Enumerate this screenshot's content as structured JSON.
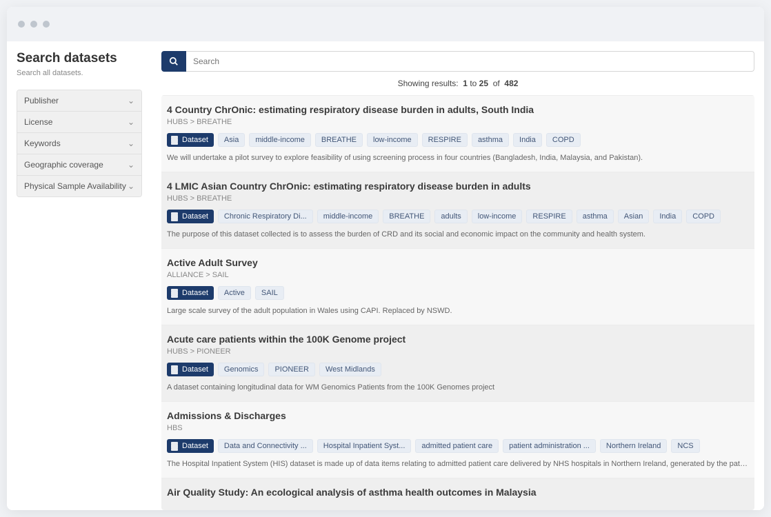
{
  "sidebar": {
    "title": "Search datasets",
    "subtitle": "Search all datasets.",
    "filters": [
      {
        "label": "Publisher"
      },
      {
        "label": "License"
      },
      {
        "label": "Keywords"
      },
      {
        "label": "Geographic coverage"
      },
      {
        "label": "Physical Sample Availability"
      }
    ]
  },
  "search": {
    "placeholder": "Search"
  },
  "results_info": {
    "prefix": "Showing results:",
    "from": "1",
    "mid": "to",
    "to": "25",
    "of_word": "of",
    "total": "482"
  },
  "badge_dataset_label": "Dataset",
  "results": [
    {
      "title": "4 Country ChrOnic: estimating respiratory disease burden in adults, South India",
      "breadcrumb": "HUBS > BREATHE",
      "tags": [
        "Asia",
        "middle-income",
        "BREATHE",
        "low-income",
        "RESPIRE",
        "asthma",
        "India",
        "COPD"
      ],
      "desc": "We will undertake a pilot survey to explore feasibility of using screening process in four countries (Bangladesh, India, Malaysia, and Pakistan)."
    },
    {
      "title": "4 LMIC Asian Country ChrOnic: estimating respiratory disease burden in adults",
      "breadcrumb": "HUBS > BREATHE",
      "tags": [
        "Chronic Respiratory Di...",
        "middle-income",
        "BREATHE",
        "adults",
        "low-income",
        "RESPIRE",
        "asthma",
        "Asian",
        "India",
        "COPD"
      ],
      "desc": "The purpose of this dataset collected is to assess the burden of CRD and its social and economic impact on the community and health system."
    },
    {
      "title": "Active Adult Survey",
      "breadcrumb": "ALLIANCE > SAIL",
      "tags": [
        "Active",
        "SAIL"
      ],
      "desc": "Large scale survey of the adult population in Wales using CAPI. Replaced by NSWD."
    },
    {
      "title": "Acute care patients within the 100K Genome project",
      "breadcrumb": "HUBS > PIONEER",
      "tags": [
        "Genomics",
        "PIONEER",
        "West Midlands"
      ],
      "desc": "A dataset containing longitudinal data for WM Genomics Patients from the 100K Genomes project"
    },
    {
      "title": "Admissions & Discharges",
      "breadcrumb": "HBS",
      "tags": [
        "Data and Connectivity ...",
        "Hospital Inpatient Syst...",
        "admitted patient care",
        "patient administration ...",
        "Northern Ireland",
        "NCS"
      ],
      "desc": "The Hospital Inpatient System (HIS) dataset is made up of data items relating to admitted patient care delivered by NHS hospitals in Northern Ireland, generated by the patient administration systems within each hos..."
    },
    {
      "title": "Air Quality Study: An ecological analysis of asthma health outcomes in Malaysia",
      "breadcrumb": "",
      "tags": [],
      "desc": ""
    }
  ]
}
